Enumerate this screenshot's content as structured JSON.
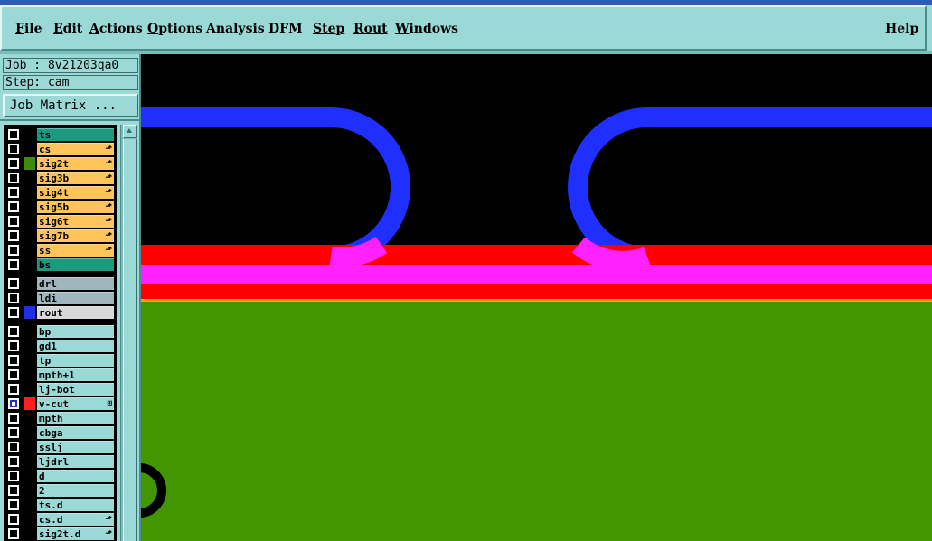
{
  "menubar": {
    "items": [
      {
        "label": "File",
        "mn": "F",
        "rest": "ile"
      },
      {
        "label": "Edit",
        "mn": "E",
        "rest": "dit"
      },
      {
        "label": "Actions",
        "mn": "A",
        "rest": "ctions"
      },
      {
        "label": "Options",
        "mn": "O",
        "rest": "ptions"
      },
      {
        "label": "Analysis",
        "mn": "",
        "rest": "Analysis"
      },
      {
        "label": "DFM",
        "mn": "",
        "rest": "DFM"
      },
      {
        "label": "Step",
        "mn": "Step",
        "rest": ""
      },
      {
        "label": "Rout",
        "mn": "Rout",
        "rest": ""
      },
      {
        "label": "Windows",
        "mn": "W",
        "rest": "indows"
      }
    ],
    "help": "Help"
  },
  "job": "Job : 8v21203qa0",
  "step": "Step: cam",
  "job_matrix_button": "Job Matrix ...",
  "layers": [
    {
      "name": "ts",
      "bg": "#1c9a7f",
      "swatch": "#000000",
      "checked": false,
      "mark": ""
    },
    {
      "name": "cs",
      "bg": "#ffc45a",
      "swatch": "#000000",
      "checked": false,
      "mark": "⬏"
    },
    {
      "name": "sig2t",
      "bg": "#ffc45a",
      "swatch": "#3f8a0a",
      "checked": false,
      "mark": "⬏"
    },
    {
      "name": "sig3b",
      "bg": "#ffc45a",
      "swatch": "#000000",
      "checked": false,
      "mark": "⬏"
    },
    {
      "name": "sig4t",
      "bg": "#ffc45a",
      "swatch": "#000000",
      "checked": false,
      "mark": "⬏"
    },
    {
      "name": "sig5b",
      "bg": "#ffc45a",
      "swatch": "#000000",
      "checked": false,
      "mark": "⬏"
    },
    {
      "name": "sig6t",
      "bg": "#ffc45a",
      "swatch": "#000000",
      "checked": false,
      "mark": "⬏"
    },
    {
      "name": "sig7b",
      "bg": "#ffc45a",
      "swatch": "#000000",
      "checked": false,
      "mark": "⬏"
    },
    {
      "name": "ss",
      "bg": "#ffc45a",
      "swatch": "#000000",
      "checked": false,
      "mark": "⬏"
    },
    {
      "name": "bs",
      "bg": "#1c9a7f",
      "swatch": "#000000",
      "checked": false,
      "mark": "",
      "group_end": true
    },
    {
      "name": "drl",
      "bg": "#9fb6bd",
      "swatch": "#000000",
      "checked": false,
      "mark": ""
    },
    {
      "name": "ldi",
      "bg": "#9fb6bd",
      "swatch": "#000000",
      "checked": false,
      "mark": ""
    },
    {
      "name": "rout",
      "bg": "#d9d9d9",
      "swatch": "#1e2fe6",
      "checked": false,
      "mark": "",
      "group_end": true
    },
    {
      "name": "bp",
      "bg": "#9ad9d6",
      "swatch": "#000000",
      "checked": false,
      "mark": ""
    },
    {
      "name": "gd1",
      "bg": "#9ad9d6",
      "swatch": "#000000",
      "checked": false,
      "mark": ""
    },
    {
      "name": "tp",
      "bg": "#9ad9d6",
      "swatch": "#000000",
      "checked": false,
      "mark": ""
    },
    {
      "name": "mpth+1",
      "bg": "#9ad9d6",
      "swatch": "#000000",
      "checked": false,
      "mark": ""
    },
    {
      "name": "lj-bot",
      "bg": "#9ad9d6",
      "swatch": "#000000",
      "checked": false,
      "mark": ""
    },
    {
      "name": "v-cut",
      "bg": "#9ad9d6",
      "swatch": "#ff1f1f",
      "checked": true,
      "mark": "⊞"
    },
    {
      "name": "mpth",
      "bg": "#9ad9d6",
      "swatch": "#000000",
      "checked": false,
      "mark": ""
    },
    {
      "name": "cbga",
      "bg": "#9ad9d6",
      "swatch": "#000000",
      "checked": false,
      "mark": ""
    },
    {
      "name": "sslj",
      "bg": "#9ad9d6",
      "swatch": "#000000",
      "checked": false,
      "mark": ""
    },
    {
      "name": "ljdrl",
      "bg": "#9ad9d6",
      "swatch": "#000000",
      "checked": false,
      "mark": ""
    },
    {
      "name": "d",
      "bg": "#9ad9d6",
      "swatch": "#000000",
      "checked": false,
      "mark": ""
    },
    {
      "name": "2",
      "bg": "#9ad9d6",
      "swatch": "#000000",
      "checked": false,
      "mark": ""
    },
    {
      "name": "ts.d",
      "bg": "#9ad9d6",
      "swatch": "#000000",
      "checked": false,
      "mark": ""
    },
    {
      "name": "cs.d",
      "bg": "#9ad9d6",
      "swatch": "#000000",
      "checked": false,
      "mark": "⬏"
    },
    {
      "name": "sig2t.d",
      "bg": "#9ad9d6",
      "swatch": "#000000",
      "checked": false,
      "mark": "⬏"
    }
  ],
  "canvas_colors": {
    "background": "#000000",
    "route": "#1e2fff",
    "red_layer": "#ff0000",
    "magenta_layer": "#ff22ff",
    "green_layer": "#429600",
    "orange_edge": "#ffa000"
  },
  "icons": [
    "scroll-up-arrow-icon",
    "attribute-mark-icon"
  ]
}
